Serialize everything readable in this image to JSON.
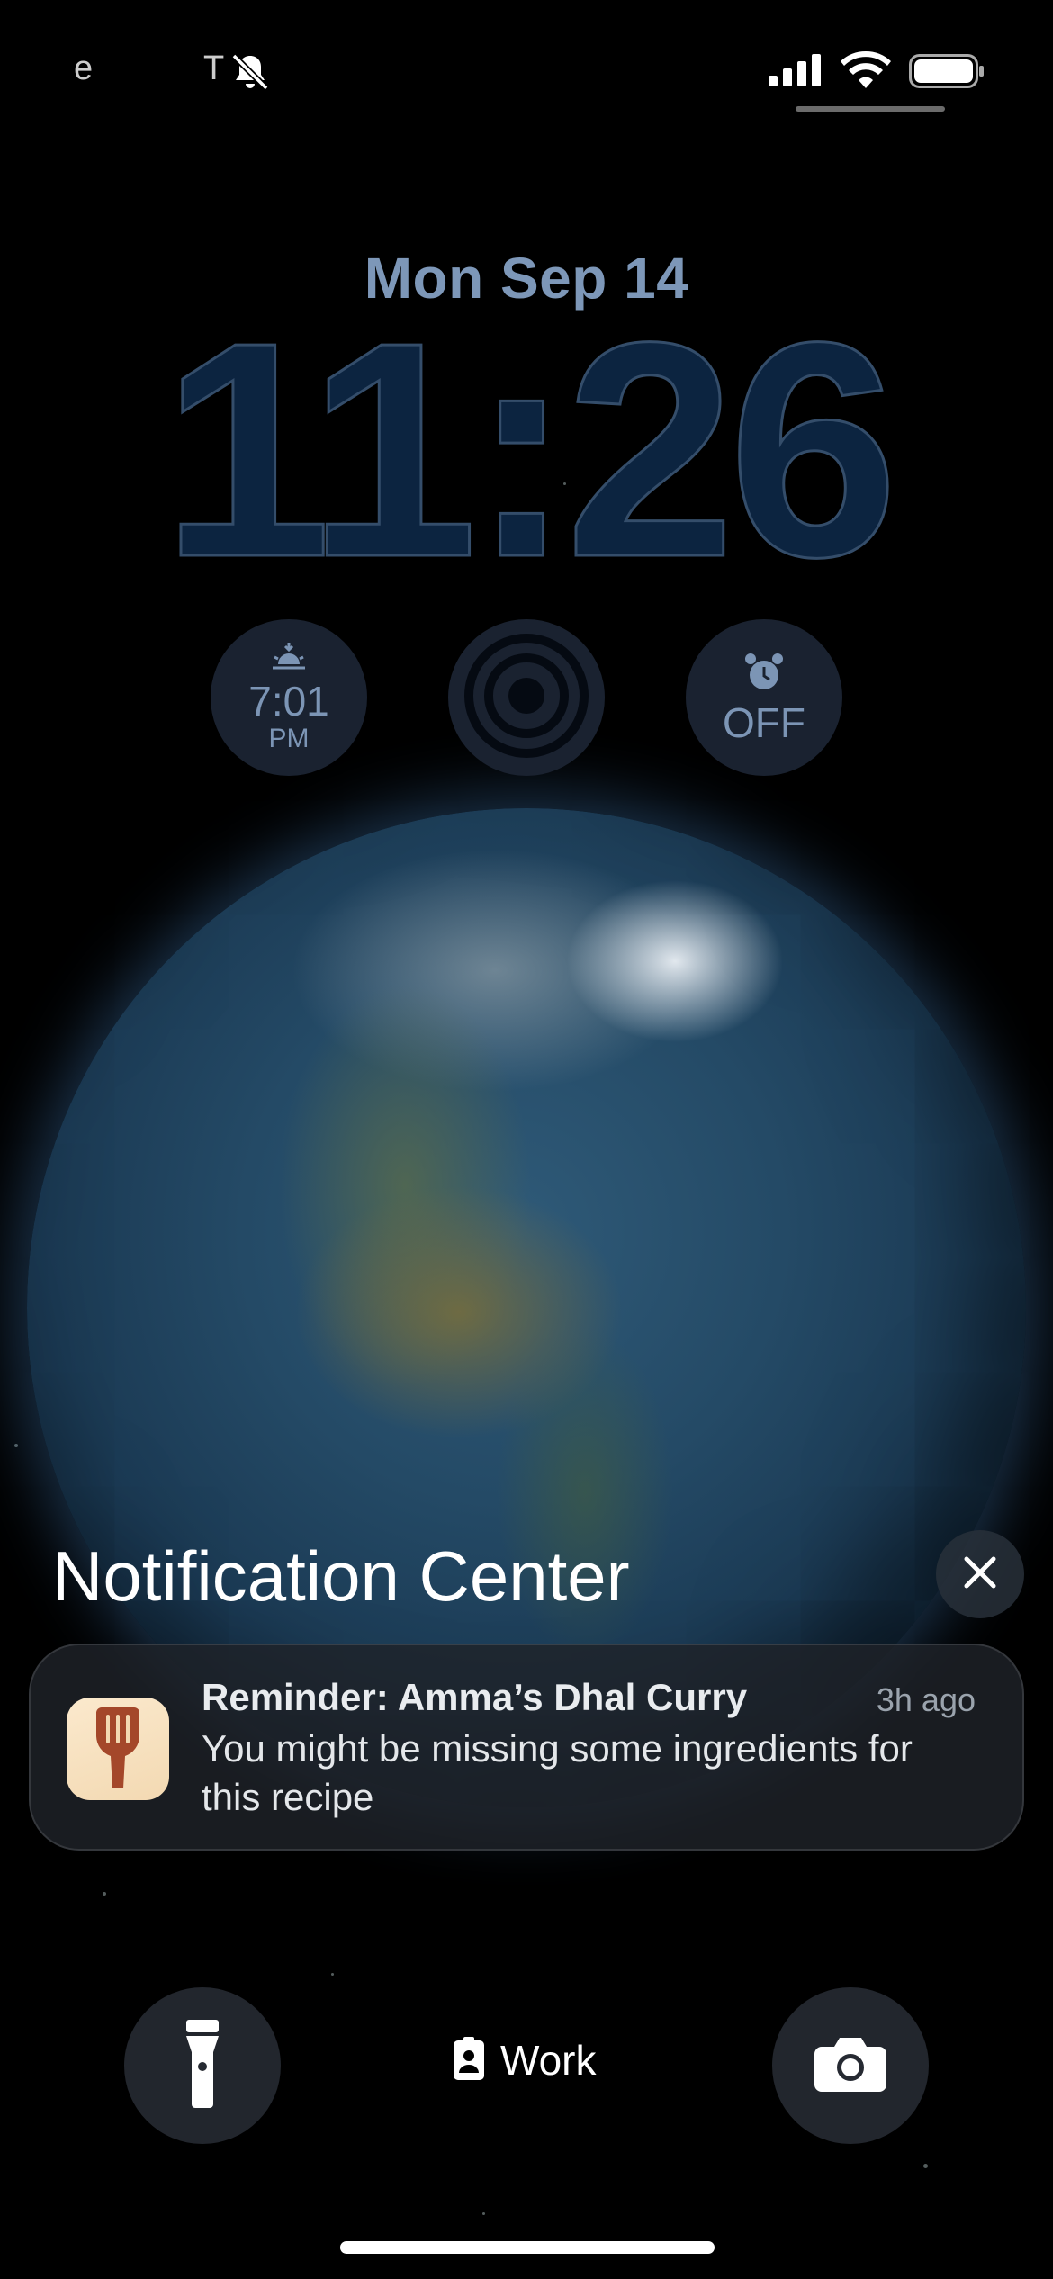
{
  "status_bar": {
    "carrier_left": "e",
    "carrier_mid": "T",
    "icons": [
      "bell-slash-icon",
      "cellular-signal-icon",
      "wifi-icon",
      "battery-icon"
    ]
  },
  "lock_screen": {
    "date": "Mon Sep 14",
    "time": "11:26"
  },
  "widgets": {
    "sunset": {
      "icon": "sunset-icon",
      "time": "7:01",
      "period": "PM"
    },
    "focus_ring": {
      "icon": "ring-icon"
    },
    "alarm": {
      "icon": "alarm-clock-icon",
      "status": "OFF"
    }
  },
  "notification_center": {
    "title": "Notification Center",
    "clear_icon": "close-icon",
    "notifications": [
      {
        "app_icon": "spatula-icon",
        "title": "Reminder: Amma’s Dhal Curry",
        "time": "3h ago",
        "body": "You might be missing some ingredients for this recipe"
      }
    ]
  },
  "bottom": {
    "flashlight_icon": "flashlight-icon",
    "focus_mode": "Work",
    "focus_icon": "id-badge-icon",
    "camera_icon": "camera-icon"
  },
  "colors": {
    "time_fill": "#0c2440",
    "date_text": "#7d97b8",
    "widget_bg": "#1a2230",
    "app_icon_bg": "#f3d9b2",
    "app_icon_fg": "#a4472a"
  }
}
